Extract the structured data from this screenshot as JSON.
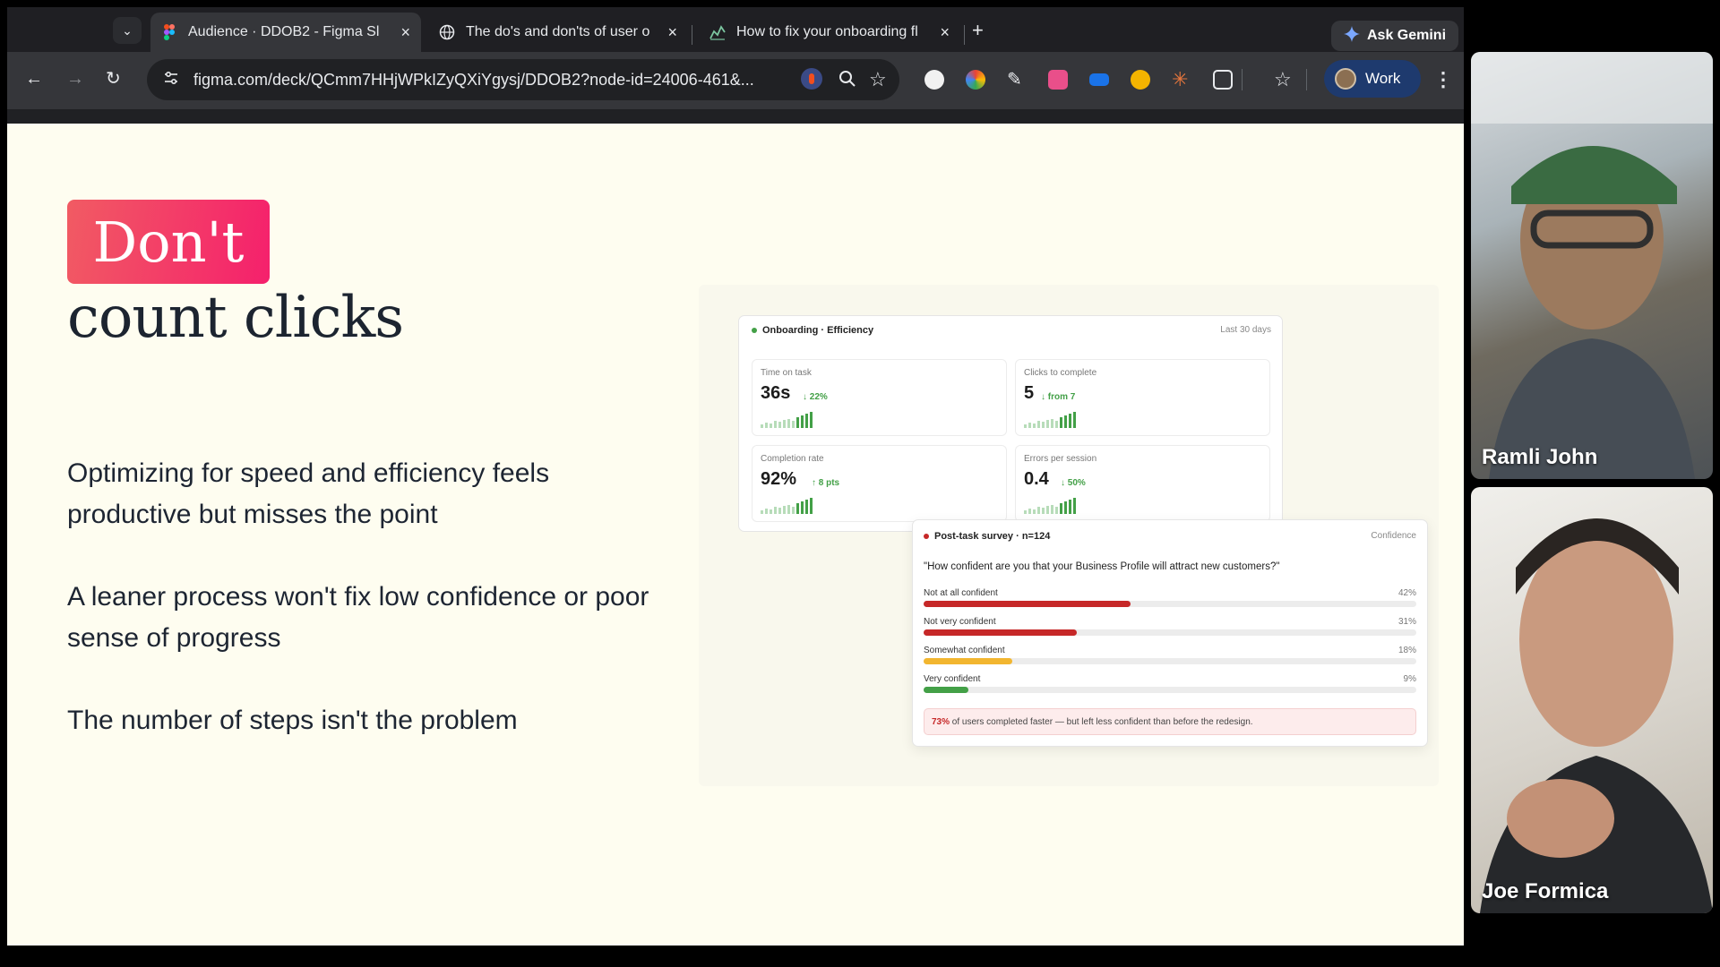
{
  "browser": {
    "tabs": [
      {
        "title": "Audience · DDOB2 - Figma Sl",
        "icon": "figma-icon",
        "active": true
      },
      {
        "title": "The do's and don'ts of user o",
        "icon": "globe-icon",
        "active": false
      },
      {
        "title": "How to fix your onboarding fl",
        "icon": "chart-icon",
        "active": false
      }
    ],
    "gemini_label": "Ask Gemini",
    "url": "figma.com/deck/QCmm7HHjWPkIZyQXiYgysj/DDOB2?node-id=24006-461&...",
    "profile_label": "Work"
  },
  "slide": {
    "badge": "Don't",
    "title": "count clicks",
    "bullets": [
      "Optimizing for speed and efficiency feels productive but misses the point",
      "A leaner process won't fix low confidence or poor sense of progress",
      "The number of steps isn't the problem"
    ]
  },
  "dashboard": {
    "title": "Onboarding · Efficiency",
    "range": "Last 30 days",
    "metrics": [
      {
        "label": "Time on task",
        "value": "36s",
        "delta": "↓ 22%"
      },
      {
        "label": "Clicks to complete",
        "value": "5",
        "delta": "↓ from 7"
      },
      {
        "label": "Completion rate",
        "value": "92%",
        "delta": "↑ 8 pts"
      },
      {
        "label": "Errors per session",
        "value": "0.4",
        "delta": "↓ 50%"
      }
    ]
  },
  "survey": {
    "title": "Post-task survey · n=124",
    "tag": "Confidence",
    "question": "\"How confident are you that your Business Profile will attract new customers?\"",
    "rows": [
      {
        "label": "Not at all confident",
        "pct": "42%",
        "value": 0.42,
        "color": "#c62828"
      },
      {
        "label": "Not very confident",
        "pct": "31%",
        "value": 0.31,
        "color": "#c62828"
      },
      {
        "label": "Somewhat confident",
        "pct": "18%",
        "value": 0.18,
        "color": "#f2b630"
      },
      {
        "label": "Very confident",
        "pct": "9%",
        "value": 0.09,
        "color": "#43a047"
      }
    ],
    "insight_highlight": "73%",
    "insight_text": " of users completed faster — but left less confident than before the redesign."
  },
  "participants": [
    {
      "name": "Ramli John"
    },
    {
      "name": "Joe Formica"
    }
  ]
}
